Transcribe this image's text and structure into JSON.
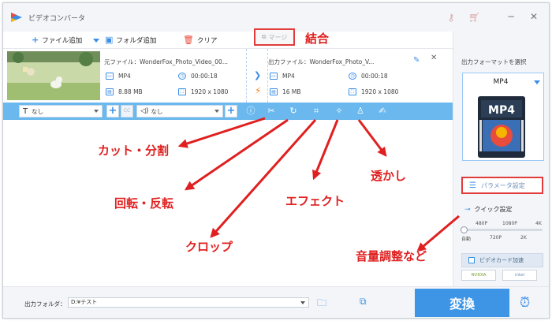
{
  "window": {
    "title": "ビデオコンバータ"
  },
  "toolbar": {
    "add_file": "ファイル追加",
    "add_folder": "フォルダ追加",
    "clear": "クリア",
    "merge": "マージ"
  },
  "file": {
    "source_label": "元ファイル：",
    "source_name": "WonderFox_Photo_Video_00...",
    "output_label": "出力ファイル：",
    "output_name": "WonderFox_Photo_V...",
    "src_format": "MP4",
    "src_duration": "00:00:18",
    "src_size": "8.88 MB",
    "src_resolution": "1920 x 1080",
    "dst_format": "MP4",
    "dst_duration": "00:00:18",
    "dst_size": "16 MB",
    "dst_resolution": "1920 x 1080"
  },
  "editbar": {
    "subtitle_value": "なし",
    "audio_value": "なし"
  },
  "right_panel": {
    "output_format_label": "出力フォーマットを選択",
    "selected_format": "MP4",
    "format_thumb_text": "MP4",
    "param_button": "パラメータ設定",
    "quick_settings_label": "クイック設定",
    "slider_top_labels": [
      "480P",
      "1080P",
      "4K"
    ],
    "slider_bottom_labels": [
      "自動",
      "720P",
      "2K"
    ],
    "gpu_label": "ビデオカード加速",
    "gpu_logos": [
      "NVIDIA",
      "intel"
    ]
  },
  "bottom": {
    "output_folder_label": "出力フォルダ：",
    "output_folder_value": "D:¥テスト",
    "convert_button": "変換"
  },
  "annotations": {
    "merge": "結合",
    "cut": "カット・分割",
    "rotate": "回転・反転",
    "crop": "クロップ",
    "effect": "エフェクト",
    "watermark": "透かし",
    "volume": "音量調整など"
  },
  "colors": {
    "accent": "#3a8ee6",
    "edit_bar": "#6ab8ee",
    "convert_button": "#3e95e6",
    "annotation": "#e02020"
  }
}
